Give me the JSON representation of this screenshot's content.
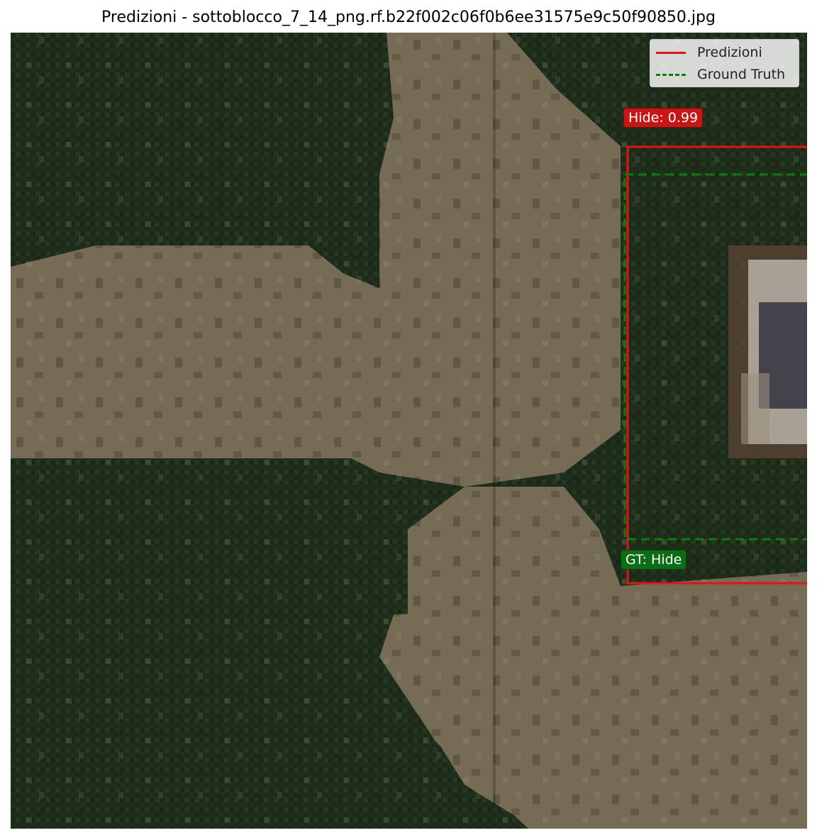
{
  "title": "Predizioni - sottoblocco_7_14_png.rf.b22f002c06f0b6ee31575e9c50f90850.jpg",
  "legend": {
    "items": [
      {
        "label": "Predizioni",
        "style": "solid",
        "color": "#e81212"
      },
      {
        "label": "Ground Truth",
        "style": "dashed",
        "color": "#0a7d0a"
      }
    ]
  },
  "prediction": {
    "class": "Hide",
    "score": 0.99,
    "label": "Hide: 0.99",
    "color": "#e81212"
  },
  "ground_truth": {
    "class": "Hide",
    "label": "GT: Hide",
    "color": "#0a7d0a"
  },
  "colors": {
    "vegetation": "#1f2f1b",
    "bare_ground": "#7a705a",
    "pred_box": "#e81212",
    "gt_box": "#0a7d0a"
  }
}
